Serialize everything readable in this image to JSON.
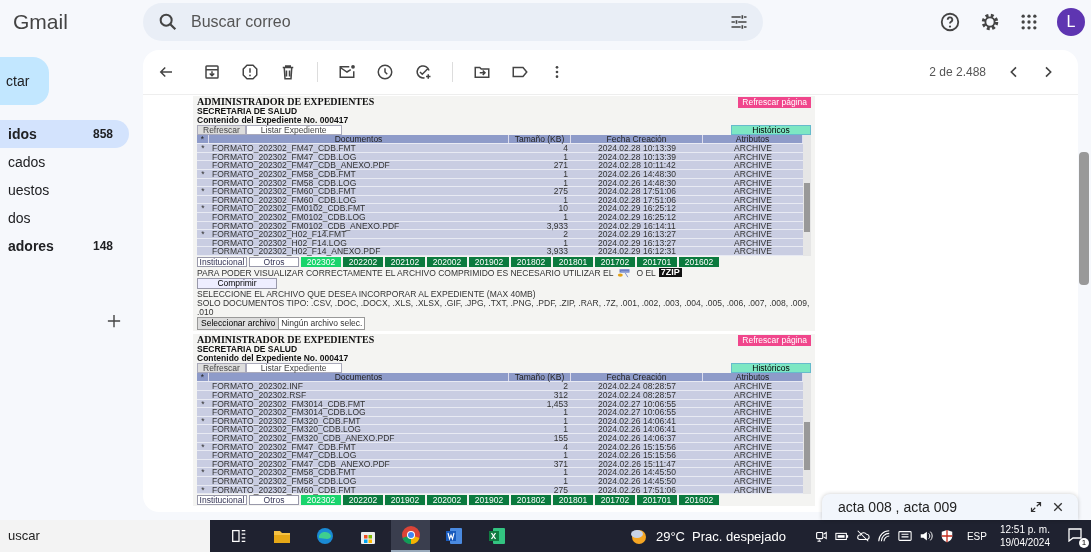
{
  "app": {
    "logo": "Gmail"
  },
  "search": {
    "placeholder": "Buscar correo"
  },
  "account": {
    "initial": "L"
  },
  "sidebar": {
    "compose": "ctar",
    "items": [
      {
        "label": "idos",
        "count": "858",
        "selected": true,
        "unread": true
      },
      {
        "label": "cados",
        "selected": false,
        "unread": false
      },
      {
        "label": "uestos",
        "selected": false,
        "unread": false
      },
      {
        "label": "dos",
        "selected": false,
        "unread": false
      },
      {
        "label": "adores",
        "count": "148",
        "selected": false,
        "unread": true
      }
    ]
  },
  "message": {
    "pager": "2 de 2.488",
    "screenshots": [
      {
        "title": "ADMINISTRADOR DE EXPEDIENTES",
        "subtitle": "SECRETARIA DE SALUD",
        "expediente": "Contenido del Expediente No. 000417",
        "refresh_page": "Refrescar página",
        "tabs": [
          {
            "label": "Refrescar",
            "selected": false
          },
          {
            "label": "Listar Expediente",
            "selected": true
          }
        ],
        "history": "Históricos",
        "mark_header": "*",
        "columns": [
          "Documentos",
          "Tamaño (KB)",
          "Fecha Creación",
          "Atributos"
        ],
        "rows": [
          {
            "mark": "*",
            "cells": [
              "FORMATO_202302_FM47_CDB.FMT",
              "4",
              "2024.02.28 10:13:39",
              "ARCHIVE"
            ]
          },
          {
            "cells": [
              "FORMATO_202302_FM47_CDB.LOG",
              "1",
              "2024.02.28 10:13:39",
              "ARCHIVE"
            ]
          },
          {
            "cells": [
              "FORMATO_202302_FM47_CDB_ANEXO.PDF",
              "271",
              "2024.02.28 10:11:42",
              "ARCHIVE"
            ]
          },
          {
            "mark": "*",
            "cells": [
              "FORMATO_202302_FM58_CDB.FMT",
              "1",
              "2024.02.26 14:48:30",
              "ARCHIVE"
            ]
          },
          {
            "cells": [
              "FORMATO_202302_FM58_CDB.LOG",
              "1",
              "2024.02.26 14:48:30",
              "ARCHIVE"
            ]
          },
          {
            "mark": "*",
            "cells": [
              "FORMATO_202302_FM60_CDB.FMT",
              "275",
              "2024.02.28 17:51:06",
              "ARCHIVE"
            ]
          },
          {
            "cells": [
              "FORMATO_202302_FM60_CDB.LOG",
              "1",
              "2024.02.28 17:51:06",
              "ARCHIVE"
            ]
          },
          {
            "mark": "*",
            "cells": [
              "FORMATO_202302_FM0102_CDB.FMT",
              "10",
              "2024.02.29 16:25:12",
              "ARCHIVE"
            ]
          },
          {
            "cells": [
              "FORMATO_202302_FM0102_CDB.LOG",
              "1",
              "2024.02.29 16:25:12",
              "ARCHIVE"
            ]
          },
          {
            "cells": [
              "FORMATO_202302_FM0102_CDB_ANEXO.PDF",
              "3,933",
              "2024.02.29 16:14:11",
              "ARCHIVE"
            ]
          },
          {
            "mark": "*",
            "cells": [
              "FORMATO_202302_H02_F14.FMT",
              "2",
              "2024.02.29 16:13:27",
              "ARCHIVE"
            ]
          },
          {
            "cells": [
              "FORMATO_202302_H02_F14.LOG",
              "1",
              "2024.02.29 16:13:27",
              "ARCHIVE"
            ]
          },
          {
            "cells": [
              "FORMATO_202302_H02_F14_ANEXO.PDF",
              "3,933",
              "2024.02.29 16:12:31",
              "ARCHIVE"
            ]
          }
        ],
        "filters": [
          "Institucional",
          "Otros"
        ],
        "periods": [
          {
            "label": "202302",
            "selected": true
          },
          {
            "label": "202202",
            "selected": false
          },
          {
            "label": "202102",
            "selected": false
          },
          {
            "label": "202002",
            "selected": false
          },
          {
            "label": "201902",
            "selected": false
          },
          {
            "label": "201802",
            "selected": false
          },
          {
            "label": "201801",
            "selected": false
          },
          {
            "label": "201702",
            "selected": false
          },
          {
            "label": "201701",
            "selected": false
          },
          {
            "label": "201602",
            "selected": false
          }
        ],
        "footer": {
          "note": "PARA PODER VISUALIZAR CORRECTAMENTE EL ARCHIVO COMPRIMIDO ES NECESARIO UTILIZAR EL",
          "or": "O EL",
          "zip_logo": "7ZIP",
          "compress": "Comprimir",
          "select_note": "SELECCIONE EL ARCHIVO QUE DESEA INCORPORAR AL EXPEDIENTE (MAX 40MB)",
          "types": "SOLO DOCUMENTOS TIPO: .CSV, .DOC, .DOCX, .XLS, .XLSX, .GIF, .JPG, .TXT, .PNG, .PDF, .ZIP, .RAR, .7Z, .001, .002, .003, .004, .005, .006, .007, .008, .009, .010",
          "file_button": "Seleccionar archivo",
          "file_status": "Ningún archivo selec."
        }
      },
      {
        "title": "ADMINISTRADOR DE EXPEDIENTES",
        "subtitle": "SECRETARIA DE SALUD",
        "expediente": "Contenido del Expediente No. 000417",
        "refresh_page": "Refrescar página",
        "tabs": [
          {
            "label": "Refrescar",
            "selected": false
          },
          {
            "label": "Listar Expediente",
            "selected": true
          }
        ],
        "history": "Históricos",
        "mark_header": "*",
        "columns": [
          "Documentos",
          "Tamaño (KB)",
          "Fecha Creación",
          "Atributos"
        ],
        "rows": [
          {
            "cells": [
              "FORMATO_202302.INF",
              "2",
              "2024.02.24 08:28:57",
              "ARCHIVE"
            ]
          },
          {
            "cells": [
              "FORMATO_202302.RSF",
              "312",
              "2024.02.24 08:28:57",
              "ARCHIVE"
            ]
          },
          {
            "mark": "*",
            "cells": [
              "FORMATO_202302_FM3014_CDB.FMT",
              "1,453",
              "2024.02.27 10:06:55",
              "ARCHIVE"
            ]
          },
          {
            "cells": [
              "FORMATO_202302_FM3014_CDB.LOG",
              "1",
              "2024.02.27 10:06:55",
              "ARCHIVE"
            ]
          },
          {
            "mark": "*",
            "cells": [
              "FORMATO_202302_FM320_CDB.FMT",
              "1",
              "2024.02.26 14:06:41",
              "ARCHIVE"
            ]
          },
          {
            "cells": [
              "FORMATO_202302_FM320_CDB.LOG",
              "1",
              "2024.02.26 14:06:41",
              "ARCHIVE"
            ]
          },
          {
            "cells": [
              "FORMATO_202302_FM320_CDB_ANEXO.PDF",
              "155",
              "2024.02.26 14:06:37",
              "ARCHIVE"
            ]
          },
          {
            "mark": "*",
            "cells": [
              "FORMATO_202302_FM47_CDB.FMT",
              "4",
              "2024.02.26 15:15:56",
              "ARCHIVE"
            ]
          },
          {
            "cells": [
              "FORMATO_202302_FM47_CDB.LOG",
              "1",
              "2024.02.26 15:15:56",
              "ARCHIVE"
            ]
          },
          {
            "cells": [
              "FORMATO_202302_FM47_CDB_ANEXO.PDF",
              "371",
              "2024.02.26 15:11:47",
              "ARCHIVE"
            ]
          },
          {
            "mark": "*",
            "cells": [
              "FORMATO_202302_FM58_CDB.FMT",
              "1",
              "2024.02.26 14:45:50",
              "ARCHIVE"
            ]
          },
          {
            "cells": [
              "FORMATO_202302_FM58_CDB.LOG",
              "1",
              "2024.02.26 14:45:50",
              "ARCHIVE"
            ]
          },
          {
            "mark": "*",
            "cells": [
              "FORMATO_202302_FM60_CDB.FMT",
              "275",
              "2024.02.26 17:51:06",
              "ARCHIVE"
            ]
          }
        ],
        "filters": [
          "Institucional",
          "Otros"
        ],
        "periods": [
          {
            "label": "202302",
            "selected": true
          },
          {
            "label": "202202",
            "selected": false
          },
          {
            "label": "201902",
            "selected": false
          },
          {
            "label": "202002",
            "selected": false
          },
          {
            "label": "201902",
            "selected": false
          },
          {
            "label": "201802",
            "selected": false
          },
          {
            "label": "201801",
            "selected": false
          },
          {
            "label": "201702",
            "selected": false
          },
          {
            "label": "201701",
            "selected": false
          },
          {
            "label": "201602",
            "selected": false
          }
        ]
      }
    ]
  },
  "popup": {
    "title": "acta 008 , acta 009"
  },
  "taskbar": {
    "search": "uscar",
    "apps": [
      {
        "kind": "taskview",
        "selected": false
      },
      {
        "kind": "folder",
        "selected": false
      },
      {
        "kind": "edge",
        "selected": false
      },
      {
        "kind": "store",
        "selected": false
      },
      {
        "kind": "chrome",
        "selected": true
      },
      {
        "kind": "word",
        "selected": false
      },
      {
        "kind": "excel",
        "selected": false
      }
    ],
    "weather": {
      "temp": "29°C",
      "text": "Prac. despejado"
    },
    "language": "ESP",
    "time": "12:51 p. m.",
    "date": "19/04/2024",
    "notifications": "1"
  }
}
